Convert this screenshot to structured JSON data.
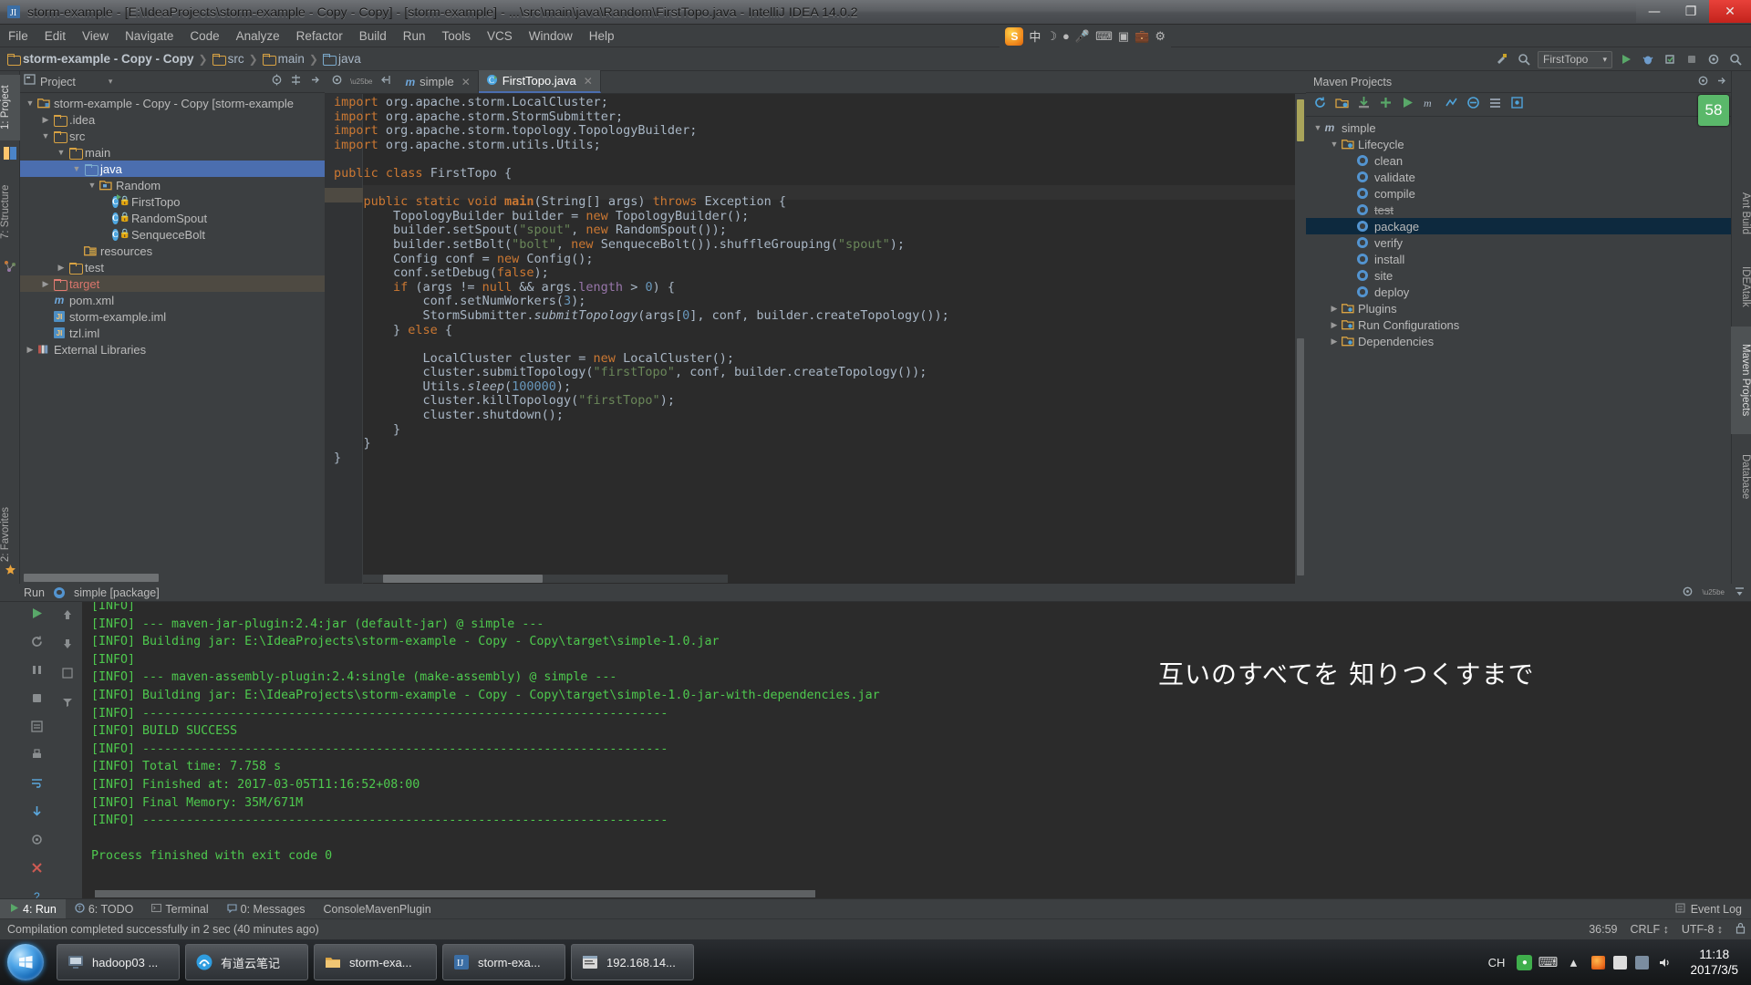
{
  "window": {
    "title": "storm-example - [E:\\IdeaProjects\\storm-example - Copy - Copy] - [storm-example] - ...\\src\\main\\java\\Random\\FirstTopo.java - IntelliJ IDEA 14.0.2",
    "minimize": "—",
    "maximize": "❐",
    "close": "✕"
  },
  "menu": {
    "items": [
      "File",
      "Edit",
      "View",
      "Navigate",
      "Code",
      "Analyze",
      "Refactor",
      "Build",
      "Run",
      "Tools",
      "VCS",
      "Window",
      "Help"
    ]
  },
  "ime": {
    "lang": "中",
    "moon": "☽",
    "dot": "●",
    "mic": "🎤",
    "kbd": "⌨",
    "box": "▣",
    "bag": "💼",
    "settings": "⚙"
  },
  "navbar": {
    "crumbs": [
      {
        "label": "storm-example - Copy - Copy",
        "icon": "module-icon",
        "bold": true
      },
      {
        "label": "src",
        "icon": "folder-icon",
        "bold": false
      },
      {
        "label": "main",
        "icon": "folder-icon",
        "bold": false
      },
      {
        "label": "java",
        "icon": "folder-blue-icon",
        "bold": false
      }
    ],
    "separator": "❯",
    "run_config": "FirstTopo",
    "run_config_caret": "▾"
  },
  "left_strip": {
    "tabs": [
      "1: Project",
      "7: Structure"
    ],
    "selected": "1: Project"
  },
  "right_strip": {
    "tabs": [
      "Ant Build",
      "IDEAtalk",
      "Maven Projects",
      "Database"
    ],
    "selected": "Maven Projects"
  },
  "badge": {
    "value": "58"
  },
  "project": {
    "panel_title": "Project",
    "panel_caret": "▾",
    "tree": [
      {
        "depth": 0,
        "arrow": "▼",
        "icon": "module-icon",
        "label": "storm-example - Copy - Copy [storm-example",
        "state": "normal",
        "bold_tail": true
      },
      {
        "depth": 1,
        "arrow": "▶",
        "icon": "folder-icon",
        "label": ".idea",
        "state": "normal"
      },
      {
        "depth": 1,
        "arrow": "▼",
        "icon": "folder-icon",
        "label": "src",
        "state": "normal"
      },
      {
        "depth": 2,
        "arrow": "▼",
        "icon": "folder-icon",
        "label": "main",
        "state": "normal"
      },
      {
        "depth": 3,
        "arrow": "▼",
        "icon": "folder-blue-icon",
        "label": "java",
        "state": "selected"
      },
      {
        "depth": 4,
        "arrow": "▼",
        "icon": "package-icon",
        "label": "Random",
        "state": "normal"
      },
      {
        "depth": 5,
        "arrow": "",
        "icon": "class-runnable-icon",
        "label": "FirstTopo",
        "state": "normal"
      },
      {
        "depth": 5,
        "arrow": "",
        "icon": "class-icon",
        "label": "RandomSpout",
        "state": "normal"
      },
      {
        "depth": 5,
        "arrow": "",
        "icon": "class-icon",
        "label": "SenqueceBolt",
        "state": "normal"
      },
      {
        "depth": 3,
        "arrow": "",
        "icon": "resources-icon",
        "label": "resources",
        "state": "normal"
      },
      {
        "depth": 2,
        "arrow": "▶",
        "icon": "folder-icon",
        "label": "test",
        "state": "normal"
      },
      {
        "depth": 1,
        "arrow": "▶",
        "icon": "folder-red-icon",
        "label": "target",
        "state": "highlighted"
      },
      {
        "depth": 1,
        "arrow": "",
        "icon": "maven-icon",
        "label": "pom.xml",
        "state": "normal"
      },
      {
        "depth": 1,
        "arrow": "",
        "icon": "iml-icon",
        "label": "storm-example.iml",
        "state": "normal"
      },
      {
        "depth": 1,
        "arrow": "",
        "icon": "iml-icon",
        "label": "tzl.iml",
        "state": "normal"
      },
      {
        "depth": 0,
        "arrow": "▶",
        "icon": "library-icon",
        "label": "External Libraries",
        "state": "normal"
      }
    ]
  },
  "editor": {
    "tabs": [
      {
        "label": "simple",
        "icon": "maven-icon",
        "active": false,
        "close": "✕"
      },
      {
        "label": "FirstTopo.java",
        "icon": "class-runnable-icon",
        "active": true,
        "close": "✕"
      }
    ],
    "source_lines": [
      "import org.apache.storm.LocalCluster;",
      "import org.apache.storm.StormSubmitter;",
      "import org.apache.storm.topology.TopologyBuilder;",
      "import org.apache.storm.utils.Utils;",
      "",
      "public class FirstTopo {",
      "",
      "    public static void main(String[] args) throws Exception {",
      "        TopologyBuilder builder = new TopologyBuilder();",
      "        builder.setSpout(\"spout\", new RandomSpout());",
      "        builder.setBolt(\"bolt\", new SenqueceBolt()).shuffleGrouping(\"spout\");",
      "        Config conf = new Config();",
      "        conf.setDebug(false);",
      "        if (args != null && args.length > 0) {",
      "            conf.setNumWorkers(3);",
      "            StormSubmitter.submitTopology(args[0], conf, builder.createTopology());",
      "        } else {",
      "",
      "            LocalCluster cluster = new LocalCluster();",
      "            cluster.submitTopology(\"firstTopo\", conf, builder.createTopology());",
      "            Utils.sleep(100000);",
      "            cluster.killTopology(\"firstTopo\");",
      "            cluster.shutdown();",
      "        }",
      "    }",
      "}"
    ]
  },
  "maven": {
    "panel_title": "Maven Projects",
    "toolbar_icons": [
      "refresh-icon",
      "add-pom-icon",
      "download-sources-icon",
      "plus-icon",
      "run-goal-icon",
      "execute-maven-goal-icon",
      "toggle-offline-icon",
      "skip-tests-icon",
      "collapse-all-icon",
      "settings-icon"
    ],
    "tree": [
      {
        "depth": 0,
        "arrow": "▼",
        "icon": "maven-project-icon",
        "label": "simple",
        "state": "normal"
      },
      {
        "depth": 1,
        "arrow": "▼",
        "icon": "lifecycle-folder-icon",
        "label": "Lifecycle",
        "state": "normal"
      },
      {
        "depth": 2,
        "arrow": "",
        "icon": "goal-icon",
        "label": "clean",
        "state": "normal"
      },
      {
        "depth": 2,
        "arrow": "",
        "icon": "goal-icon",
        "label": "validate",
        "state": "normal"
      },
      {
        "depth": 2,
        "arrow": "",
        "icon": "goal-icon",
        "label": "compile",
        "state": "normal"
      },
      {
        "depth": 2,
        "arrow": "",
        "icon": "goal-icon",
        "label": "test",
        "state": "strikethrough"
      },
      {
        "depth": 2,
        "arrow": "",
        "icon": "goal-icon",
        "label": "package",
        "state": "selected"
      },
      {
        "depth": 2,
        "arrow": "",
        "icon": "goal-icon",
        "label": "verify",
        "state": "normal"
      },
      {
        "depth": 2,
        "arrow": "",
        "icon": "goal-icon",
        "label": "install",
        "state": "normal"
      },
      {
        "depth": 2,
        "arrow": "",
        "icon": "goal-icon",
        "label": "site",
        "state": "normal"
      },
      {
        "depth": 2,
        "arrow": "",
        "icon": "goal-icon",
        "label": "deploy",
        "state": "normal"
      },
      {
        "depth": 1,
        "arrow": "▶",
        "icon": "plugins-folder-icon",
        "label": "Plugins",
        "state": "normal"
      },
      {
        "depth": 1,
        "arrow": "▶",
        "icon": "runconfig-folder-icon",
        "label": "Run Configurations",
        "state": "normal"
      },
      {
        "depth": 1,
        "arrow": "▶",
        "icon": "dependencies-folder-icon",
        "label": "Dependencies",
        "state": "normal"
      }
    ]
  },
  "run": {
    "label": "Run",
    "config_name": "simple [package]",
    "console_lines": [
      "[INFO]",
      "[INFO] --- maven-jar-plugin:2.4:jar (default-jar) @ simple ---",
      "[INFO] Building jar: E:\\IdeaProjects\\storm-example - Copy - Copy\\target\\simple-1.0.jar",
      "[INFO]",
      "[INFO] --- maven-assembly-plugin:2.4:single (make-assembly) @ simple ---",
      "[INFO] Building jar: E:\\IdeaProjects\\storm-example - Copy - Copy\\target\\simple-1.0-jar-with-dependencies.jar",
      "[INFO] ------------------------------------------------------------------------",
      "[INFO] BUILD SUCCESS",
      "[INFO] ------------------------------------------------------------------------",
      "[INFO] Total time: 7.758 s",
      "[INFO] Finished at: 2017-03-05T11:16:52+08:00",
      "[INFO] Final Memory: 35M/671M",
      "[INFO] ------------------------------------------------------------------------",
      "",
      "Process finished with exit code 0"
    ],
    "overlay_text": "互いのすべてを 知りつくすまで"
  },
  "bottom_tabs": {
    "items": [
      {
        "label": "4: Run",
        "icon": "run-icon",
        "selected": true
      },
      {
        "label": "6: TODO",
        "icon": "todo-icon",
        "selected": false
      },
      {
        "label": "Terminal",
        "icon": "terminal-icon",
        "selected": false
      },
      {
        "label": "0: Messages",
        "icon": "messages-icon",
        "selected": false
      },
      {
        "label": "ConsoleMavenPlugin",
        "icon": "",
        "selected": false
      }
    ],
    "event_log": "Event Log"
  },
  "statusbar": {
    "message": "Compilation completed successfully in 2 sec (40 minutes ago)",
    "caret": "36:59",
    "line_sep": "CRLF ↕",
    "encoding": "UTF-8 ↕",
    "lock": "🔒"
  },
  "taskbar": {
    "start_label": "",
    "buttons": [
      {
        "label": "hadoop03 ...",
        "icon": "remote-desktop-icon"
      },
      {
        "label": "有道云笔记",
        "icon": "youdao-icon"
      },
      {
        "label": "storm-exa...",
        "icon": "explorer-icon"
      },
      {
        "label": "storm-exa...",
        "icon": "idea-icon"
      },
      {
        "label": "192.168.14...",
        "icon": "terminal-window-icon"
      }
    ],
    "tray": {
      "lang": "CH",
      "ime_icons": [
        "●",
        "⌨",
        "▴",
        "🎨",
        "📄",
        "🖴",
        "🔊"
      ],
      "time": "11:18",
      "date": "2017/3/5"
    }
  }
}
